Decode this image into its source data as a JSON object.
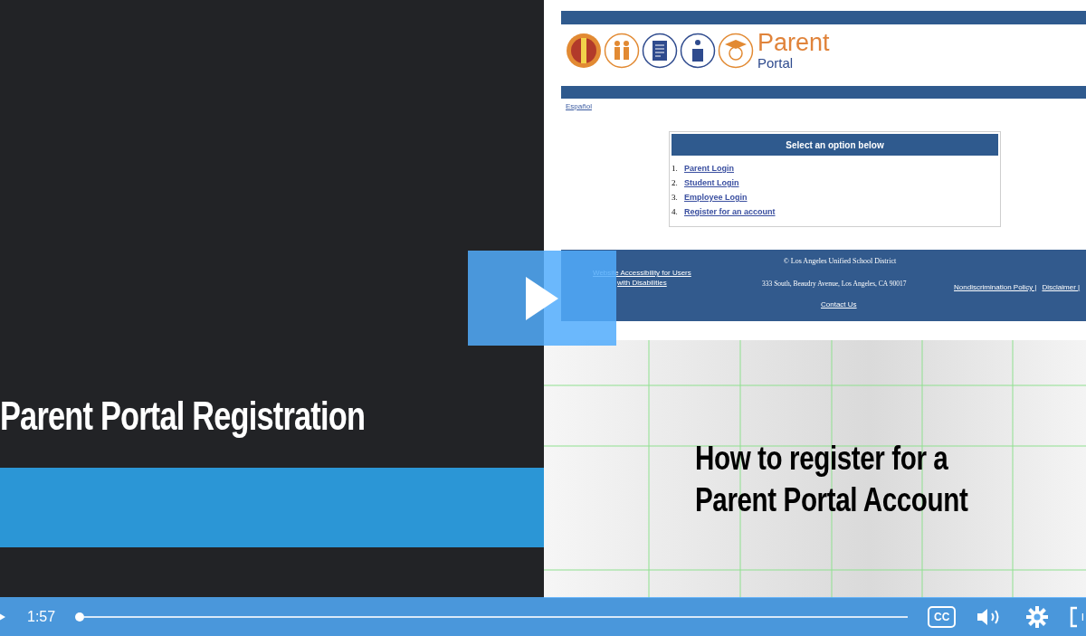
{
  "slide": {
    "title": "Parent Portal Registration",
    "subtitle_lines": [
      "How to register for a",
      "Parent Portal Account"
    ]
  },
  "portal": {
    "logo_word": "Parent",
    "logo_subword": "Portal",
    "language_link": "Español",
    "options_title": "Select an option below",
    "options": [
      {
        "number": "1.",
        "label": "Parent Login"
      },
      {
        "number": "2.",
        "label": "Student Login"
      },
      {
        "number": "3.",
        "label": "Employee Login"
      },
      {
        "number": "4.",
        "label": "Register for an account"
      }
    ],
    "footer": {
      "copyright": "© Los Angeles Unified School District",
      "accessibility_lines": [
        "Website Accessibility for Users",
        "with Disabilities"
      ],
      "address": "333 South, Beaudry Avenue, Los Angeles, CA 90017",
      "contact": "Contact Us",
      "policy_links": [
        "Nondiscrimination Policy |",
        "Disclaimer |"
      ]
    }
  },
  "player": {
    "time": "1:57",
    "progress": {
      "level": 0
    },
    "cc_label": "CC"
  }
}
